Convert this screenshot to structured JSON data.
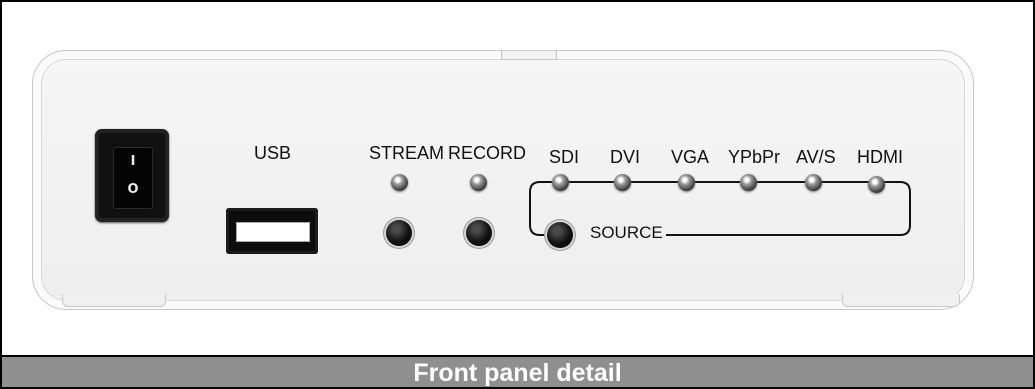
{
  "power_switch": {
    "on_mark": "I",
    "off_mark": "O"
  },
  "labels": {
    "usb": "USB",
    "stream": "STREAM",
    "record": "RECORD",
    "source": "SOURCE",
    "inputs": [
      "SDI",
      "DVI",
      "VGA",
      "YPbPr",
      "AV/S",
      "HDMI"
    ]
  },
  "caption": "Front panel detail",
  "colors": {
    "caption_bar": "#8f8f8f",
    "caption_text": "#ffffff",
    "device_body": "#f0f0f0"
  }
}
